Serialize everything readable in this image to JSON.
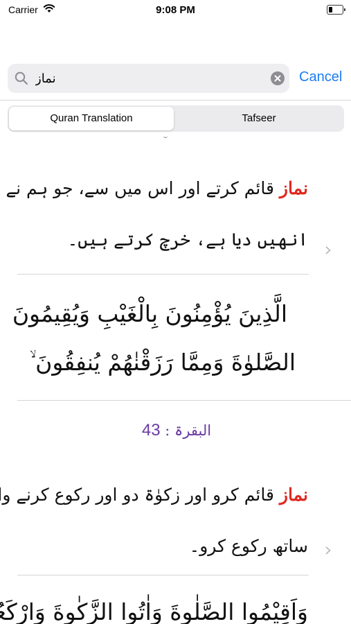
{
  "status_bar": {
    "carrier": "Carrier",
    "time": "9:08 PM",
    "battery_level": 0.25
  },
  "search": {
    "query": "نماز",
    "cancel_label": "Cancel"
  },
  "tabs": [
    {
      "label": "Quran Translation",
      "selected": true
    },
    {
      "label": "Tafseer",
      "selected": false
    }
  ],
  "results": {
    "r1": {
      "keyword": "نماز",
      "line1_rest": " قائم کرتے اور اس میں سے، جو ہم نے",
      "line2": "انھیں دیا ہے، خرچ کرتے ہیں۔",
      "arabic_line1": "الَّذِينَ يُؤْمِنُونَ بِالْغَيْبِ وَيُقِيمُونَ",
      "arabic_line2": "الصَّلوٰةَ وَمِمَّا رَزَقْنٰهُمْ يُنفِقُونَ ۙ"
    },
    "r2": {
      "ref_surah": "البقرۃ",
      "ref_sep": " : ",
      "ref_ayah": "43",
      "keyword": "نماز",
      "line1_rest": " قائم کرو اور زکوٰۃ دو اور رکوع کرنے والوں کے",
      "line2": "ساتھ رکوع کرو۔",
      "arabic_line1": "وَاَقِيْمُوا الصَّلٰوةَ وَاٰتُوا الزَّكٰوةَ وَارْكَعُوْا"
    }
  },
  "colors": {
    "accent": "#1d7cf2",
    "keyword": "#e0281f",
    "reference": "#6b3aa0"
  }
}
